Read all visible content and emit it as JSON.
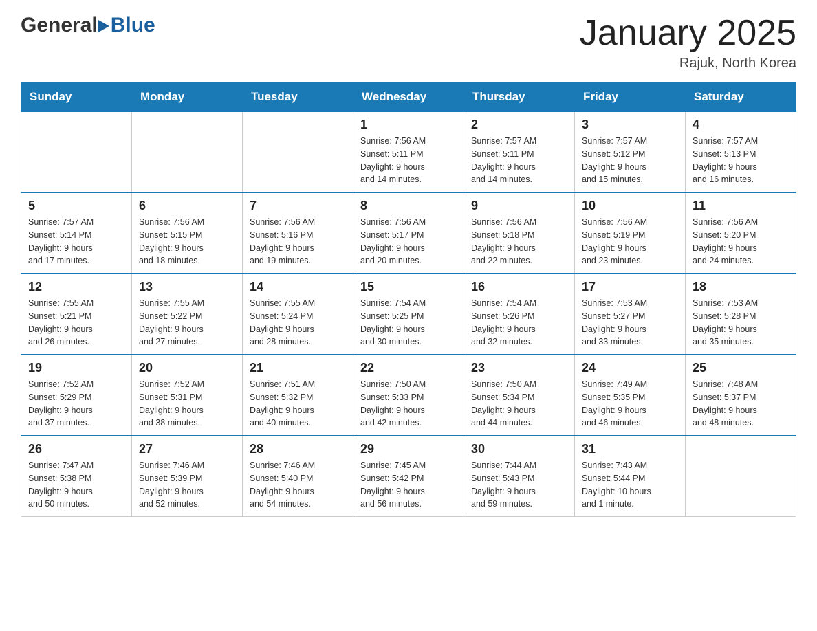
{
  "logo": {
    "general": "General",
    "blue": "Blue"
  },
  "title": "January 2025",
  "subtitle": "Rajuk, North Korea",
  "days_of_week": [
    "Sunday",
    "Monday",
    "Tuesday",
    "Wednesday",
    "Thursday",
    "Friday",
    "Saturday"
  ],
  "weeks": [
    [
      {
        "day": "",
        "info": ""
      },
      {
        "day": "",
        "info": ""
      },
      {
        "day": "",
        "info": ""
      },
      {
        "day": "1",
        "info": "Sunrise: 7:56 AM\nSunset: 5:11 PM\nDaylight: 9 hours\nand 14 minutes."
      },
      {
        "day": "2",
        "info": "Sunrise: 7:57 AM\nSunset: 5:11 PM\nDaylight: 9 hours\nand 14 minutes."
      },
      {
        "day": "3",
        "info": "Sunrise: 7:57 AM\nSunset: 5:12 PM\nDaylight: 9 hours\nand 15 minutes."
      },
      {
        "day": "4",
        "info": "Sunrise: 7:57 AM\nSunset: 5:13 PM\nDaylight: 9 hours\nand 16 minutes."
      }
    ],
    [
      {
        "day": "5",
        "info": "Sunrise: 7:57 AM\nSunset: 5:14 PM\nDaylight: 9 hours\nand 17 minutes."
      },
      {
        "day": "6",
        "info": "Sunrise: 7:56 AM\nSunset: 5:15 PM\nDaylight: 9 hours\nand 18 minutes."
      },
      {
        "day": "7",
        "info": "Sunrise: 7:56 AM\nSunset: 5:16 PM\nDaylight: 9 hours\nand 19 minutes."
      },
      {
        "day": "8",
        "info": "Sunrise: 7:56 AM\nSunset: 5:17 PM\nDaylight: 9 hours\nand 20 minutes."
      },
      {
        "day": "9",
        "info": "Sunrise: 7:56 AM\nSunset: 5:18 PM\nDaylight: 9 hours\nand 22 minutes."
      },
      {
        "day": "10",
        "info": "Sunrise: 7:56 AM\nSunset: 5:19 PM\nDaylight: 9 hours\nand 23 minutes."
      },
      {
        "day": "11",
        "info": "Sunrise: 7:56 AM\nSunset: 5:20 PM\nDaylight: 9 hours\nand 24 minutes."
      }
    ],
    [
      {
        "day": "12",
        "info": "Sunrise: 7:55 AM\nSunset: 5:21 PM\nDaylight: 9 hours\nand 26 minutes."
      },
      {
        "day": "13",
        "info": "Sunrise: 7:55 AM\nSunset: 5:22 PM\nDaylight: 9 hours\nand 27 minutes."
      },
      {
        "day": "14",
        "info": "Sunrise: 7:55 AM\nSunset: 5:24 PM\nDaylight: 9 hours\nand 28 minutes."
      },
      {
        "day": "15",
        "info": "Sunrise: 7:54 AM\nSunset: 5:25 PM\nDaylight: 9 hours\nand 30 minutes."
      },
      {
        "day": "16",
        "info": "Sunrise: 7:54 AM\nSunset: 5:26 PM\nDaylight: 9 hours\nand 32 minutes."
      },
      {
        "day": "17",
        "info": "Sunrise: 7:53 AM\nSunset: 5:27 PM\nDaylight: 9 hours\nand 33 minutes."
      },
      {
        "day": "18",
        "info": "Sunrise: 7:53 AM\nSunset: 5:28 PM\nDaylight: 9 hours\nand 35 minutes."
      }
    ],
    [
      {
        "day": "19",
        "info": "Sunrise: 7:52 AM\nSunset: 5:29 PM\nDaylight: 9 hours\nand 37 minutes."
      },
      {
        "day": "20",
        "info": "Sunrise: 7:52 AM\nSunset: 5:31 PM\nDaylight: 9 hours\nand 38 minutes."
      },
      {
        "day": "21",
        "info": "Sunrise: 7:51 AM\nSunset: 5:32 PM\nDaylight: 9 hours\nand 40 minutes."
      },
      {
        "day": "22",
        "info": "Sunrise: 7:50 AM\nSunset: 5:33 PM\nDaylight: 9 hours\nand 42 minutes."
      },
      {
        "day": "23",
        "info": "Sunrise: 7:50 AM\nSunset: 5:34 PM\nDaylight: 9 hours\nand 44 minutes."
      },
      {
        "day": "24",
        "info": "Sunrise: 7:49 AM\nSunset: 5:35 PM\nDaylight: 9 hours\nand 46 minutes."
      },
      {
        "day": "25",
        "info": "Sunrise: 7:48 AM\nSunset: 5:37 PM\nDaylight: 9 hours\nand 48 minutes."
      }
    ],
    [
      {
        "day": "26",
        "info": "Sunrise: 7:47 AM\nSunset: 5:38 PM\nDaylight: 9 hours\nand 50 minutes."
      },
      {
        "day": "27",
        "info": "Sunrise: 7:46 AM\nSunset: 5:39 PM\nDaylight: 9 hours\nand 52 minutes."
      },
      {
        "day": "28",
        "info": "Sunrise: 7:46 AM\nSunset: 5:40 PM\nDaylight: 9 hours\nand 54 minutes."
      },
      {
        "day": "29",
        "info": "Sunrise: 7:45 AM\nSunset: 5:42 PM\nDaylight: 9 hours\nand 56 minutes."
      },
      {
        "day": "30",
        "info": "Sunrise: 7:44 AM\nSunset: 5:43 PM\nDaylight: 9 hours\nand 59 minutes."
      },
      {
        "day": "31",
        "info": "Sunrise: 7:43 AM\nSunset: 5:44 PM\nDaylight: 10 hours\nand 1 minute."
      },
      {
        "day": "",
        "info": ""
      }
    ]
  ]
}
